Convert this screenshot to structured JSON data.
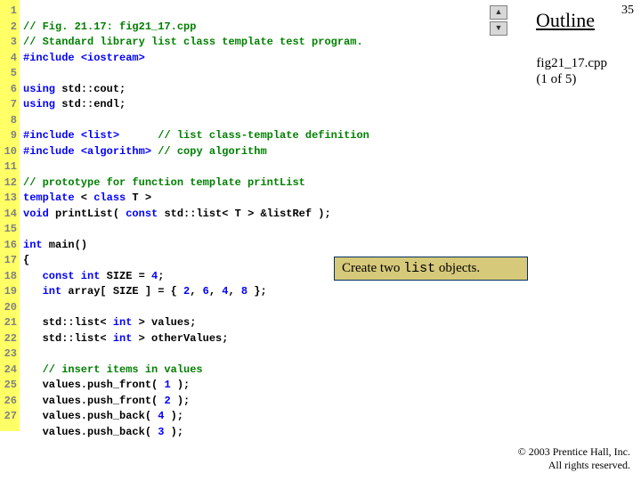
{
  "header": {
    "outline": "Outline",
    "page_num": "35"
  },
  "file_label": {
    "line1": "fig21_17.cpp",
    "line2": "(1 of 5)"
  },
  "nav": {
    "up": "▲",
    "down": "▼"
  },
  "callout": {
    "prefix": "Create two ",
    "mono": "list",
    "suffix": " objects."
  },
  "footer": {
    "line1": "© 2003 Prentice Hall, Inc.",
    "line2": "All rights reserved."
  },
  "gutter_lines": [
    "1",
    "2",
    "3",
    "4",
    "5",
    "6",
    "7",
    "8",
    "9",
    "10",
    "11",
    "12",
    "13",
    "14",
    "15",
    "16",
    "17",
    "18",
    "19",
    "20",
    "21",
    "22",
    "23",
    "24",
    "25",
    "26",
    "27"
  ],
  "code": {
    "l1": "// Fig. 21.17: fig21_17.cpp",
    "l2": "// Standard library list class template test program.",
    "l3a": "#include ",
    "l3b": "<iostream>",
    "l5a": "using ",
    "l5b": "std::cout;",
    "l6a": "using ",
    "l6b": "std::endl;",
    "l8a": "#include ",
    "l8b": "<list>",
    "l8c": "      // list class-template definition",
    "l9a": "#include ",
    "l9b": "<algorithm>",
    "l9c": " // copy algorithm",
    "l11": "// prototype for function template printList",
    "l12a": "template",
    "l12b": " < ",
    "l12c": "class",
    "l12d": " T >",
    "l13a": "void",
    "l13b": " printList( ",
    "l13c": "const",
    "l13d": " std::list< T > &listRef );",
    "l15a": "int",
    "l15b": " main()",
    "l16": "{",
    "l17a": "   const int",
    "l17b": " SIZE = ",
    "l17c": "4",
    "l17d": ";",
    "l18a": "   int",
    "l18b": " array[ SIZE ] = { ",
    "l18c": "2",
    "l18d": ", ",
    "l18e": "6",
    "l18f": ", ",
    "l18g": "4",
    "l18h": ", ",
    "l18i": "8",
    "l18j": " };",
    "l20a": "   std::list< ",
    "l20b": "int",
    "l20c": " > values;",
    "l21a": "   std::list< ",
    "l21b": "int",
    "l21c": " > otherValues;",
    "l23": "   // insert items in values",
    "l24a": "   values.push_front( ",
    "l24b": "1",
    "l24c": " );",
    "l25a": "   values.push_front( ",
    "l25b": "2",
    "l25c": " );",
    "l26a": "   values.push_back( ",
    "l26b": "4",
    "l26c": " );",
    "l27a": "   values.push_back( ",
    "l27b": "3",
    "l27c": " );"
  }
}
